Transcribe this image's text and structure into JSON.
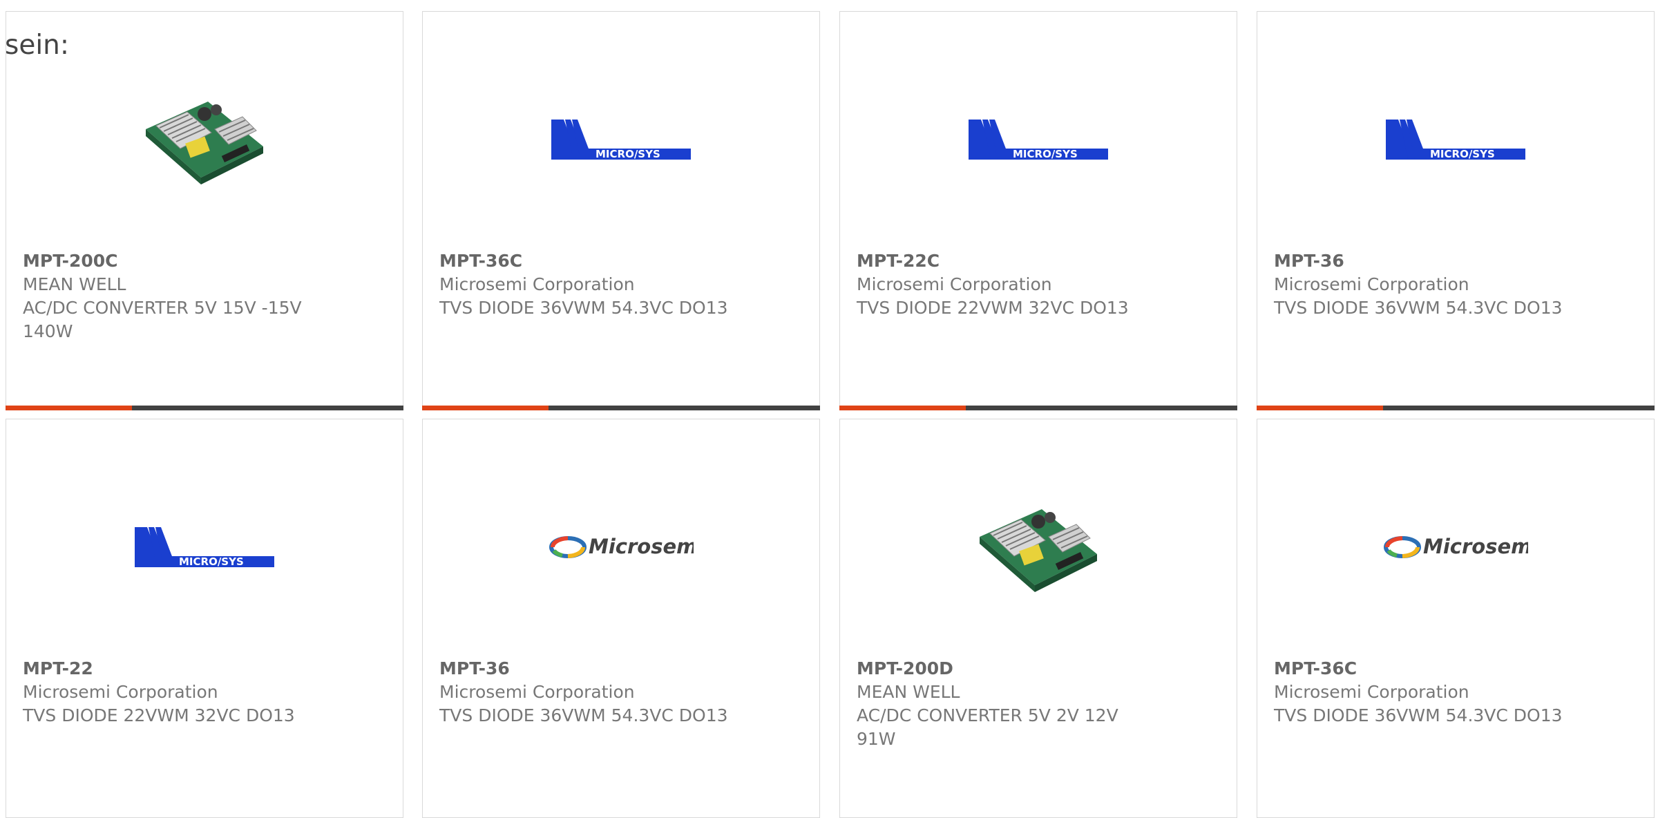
{
  "intro": "sein:",
  "colors": {
    "accent": "#e04316",
    "bar": "#424242",
    "microsys_blue": "#1a3fcf"
  },
  "products": [
    {
      "part": "MPT-200C",
      "maker": "MEAN WELL",
      "desc": "AC/DC CONVERTER 5V 15V -15V 140W",
      "image": "power-supply-board"
    },
    {
      "part": "MPT-36C",
      "maker": "Microsemi Corporation",
      "desc": "TVS DIODE 36VWM 54.3VC DO13",
      "image": "microsys-logo",
      "logo_text": "MICRO/SYS"
    },
    {
      "part": "MPT-22C",
      "maker": "Microsemi Corporation",
      "desc": "TVS DIODE 22VWM 32VC DO13",
      "image": "microsys-logo",
      "logo_text": "MICRO/SYS"
    },
    {
      "part": "MPT-36",
      "maker": "Microsemi Corporation",
      "desc": "TVS DIODE 36VWM 54.3VC DO13",
      "image": "microsys-logo",
      "logo_text": "MICRO/SYS"
    },
    {
      "part": "MPT-22",
      "maker": "Microsemi Corporation",
      "desc": "TVS DIODE 22VWM 32VC DO13",
      "image": "microsys-logo",
      "logo_text": "MICRO/SYS"
    },
    {
      "part": "MPT-36",
      "maker": "Microsemi Corporation",
      "desc": "TVS DIODE 36VWM 54.3VC DO13",
      "image": "microsemi-logo",
      "logo_text": "Microsemi"
    },
    {
      "part": "MPT-200D",
      "maker": "MEAN WELL",
      "desc": "AC/DC CONVERTER 5V 2V 12V 91W",
      "image": "power-supply-board"
    },
    {
      "part": "MPT-36C",
      "maker": "Microsemi Corporation",
      "desc": "TVS DIODE 36VWM 54.3VC DO13",
      "image": "microsemi-logo",
      "logo_text": "Microsemi"
    }
  ]
}
